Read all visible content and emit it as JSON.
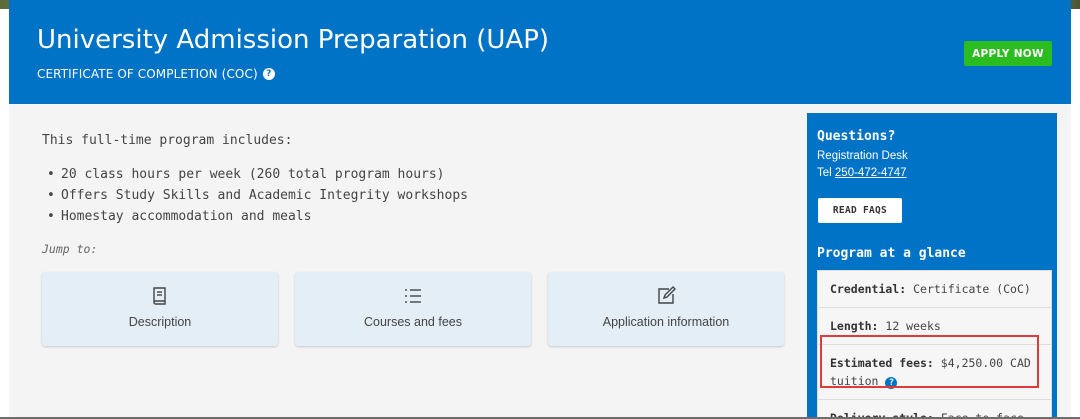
{
  "hero": {
    "title": "University Admission Preparation (UAP)",
    "subtitle": "CERTIFICATE OF COMPLETION (COC)",
    "apply_label": "APPLY NOW"
  },
  "main": {
    "intro": "This full-time program includes:",
    "bullets": [
      "20 class hours per week (260 total program hours)",
      "Offers Study Skills and Academic Integrity workshops",
      "Homestay accommodation and meals"
    ],
    "jump_label": "Jump to:",
    "jump_cards": [
      {
        "label": "Description",
        "icon": "book-icon"
      },
      {
        "label": "Courses and fees",
        "icon": "list-icon"
      },
      {
        "label": "Application information",
        "icon": "edit-icon"
      }
    ]
  },
  "sidebar": {
    "questions_heading": "Questions?",
    "contact_name": "Registration Desk",
    "tel_prefix": "Tel",
    "tel_number": "250-472-4747",
    "faq_label": "READ FAQS",
    "glance_heading": "Program at a glance",
    "glance": [
      {
        "label": "Credential:",
        "value": "Certificate (CoC)"
      },
      {
        "label": "Length:",
        "value": "12 weeks"
      },
      {
        "label": "Estimated fees:",
        "value": "$4,250.00 CAD tuition"
      },
      {
        "label": "Delivery style:",
        "value": "Face to face"
      }
    ]
  },
  "colors": {
    "brand_blue": "#0073c6",
    "apply_green": "#2bbd1f",
    "card_bg": "#e4eef7",
    "highlight_red": "#e03a3a"
  }
}
